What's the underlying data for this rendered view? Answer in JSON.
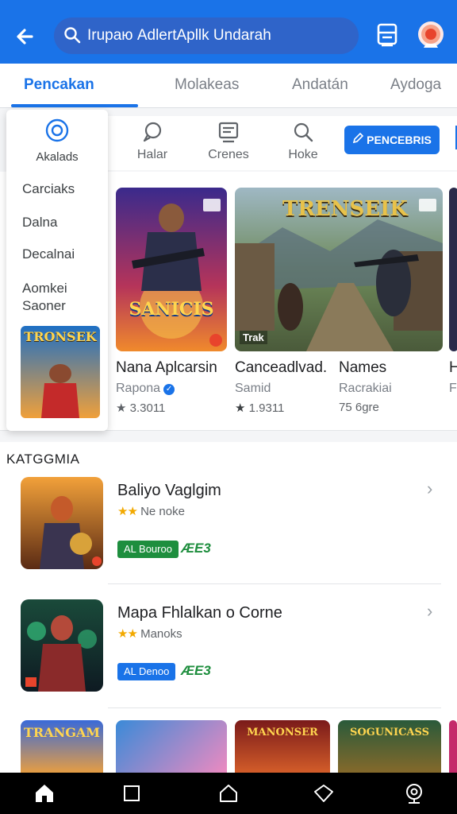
{
  "colors": {
    "accent": "#1a73e8",
    "price_green": "#1e8e3e",
    "pill_green": "#1e8e3e",
    "star_gold": "#f2a900"
  },
  "search": {
    "text": "Irupaю AdlertApllk Undarah",
    "icon": "search-icon"
  },
  "tabs": [
    {
      "label": "Pencakan",
      "active": true
    },
    {
      "label": "Molakeas",
      "active": false
    },
    {
      "label": "Andatán",
      "active": false
    },
    {
      "label": "Aydoga",
      "active": false
    }
  ],
  "quick": [
    {
      "label": "Halar",
      "icon": "chat-icon"
    },
    {
      "label": "Crenes",
      "icon": "list-icon"
    },
    {
      "label": "Hoke",
      "icon": "search-icon"
    }
  ],
  "install_button": {
    "label": "PENCEBRIS",
    "icon": "pen-icon"
  },
  "dropdown": {
    "top_label": "Akalads",
    "items": [
      "Carciaks",
      "Dalna",
      "Decalnai",
      "Aomkei",
      "Saoner"
    ]
  },
  "featured": [
    {
      "title": "Nana Aplcarsin",
      "sub": "Rapona",
      "rating": "3.3011",
      "verified": true,
      "art_text": "SANICIS"
    },
    {
      "title": "Canceadlvad.",
      "sub": "Samid",
      "rating": "1.9311",
      "verified": false,
      "art_text": "TRENSEIK",
      "badge": "Trak"
    },
    {
      "title": "Names",
      "sub": "Racrakiai",
      "rating": "75 6gre",
      "verified": false
    },
    {
      "title": "H",
      "sub": "F",
      "rating": "",
      "verified": false
    }
  ],
  "category": {
    "title": "KATGGMIA",
    "rows": [
      {
        "name": "Baliyo Vaglgim",
        "rating_text": "Ne noke",
        "stars": "★★",
        "pill": "AL Bouroo",
        "pill_color": "#1e8e3e",
        "price": "ÆE3"
      },
      {
        "name": "Mapa Fhlalkan o Corne",
        "rating_text": "Manoks",
        "stars": "★★",
        "pill": "AL Denoo",
        "pill_color": "#1a73e8",
        "price": "ÆE3"
      }
    ]
  },
  "bottom_strip": [
    "TRANGAM",
    "",
    "MANONSER",
    "SOGUNICASS"
  ],
  "dropdown_thumb_text": "TRONSEK"
}
